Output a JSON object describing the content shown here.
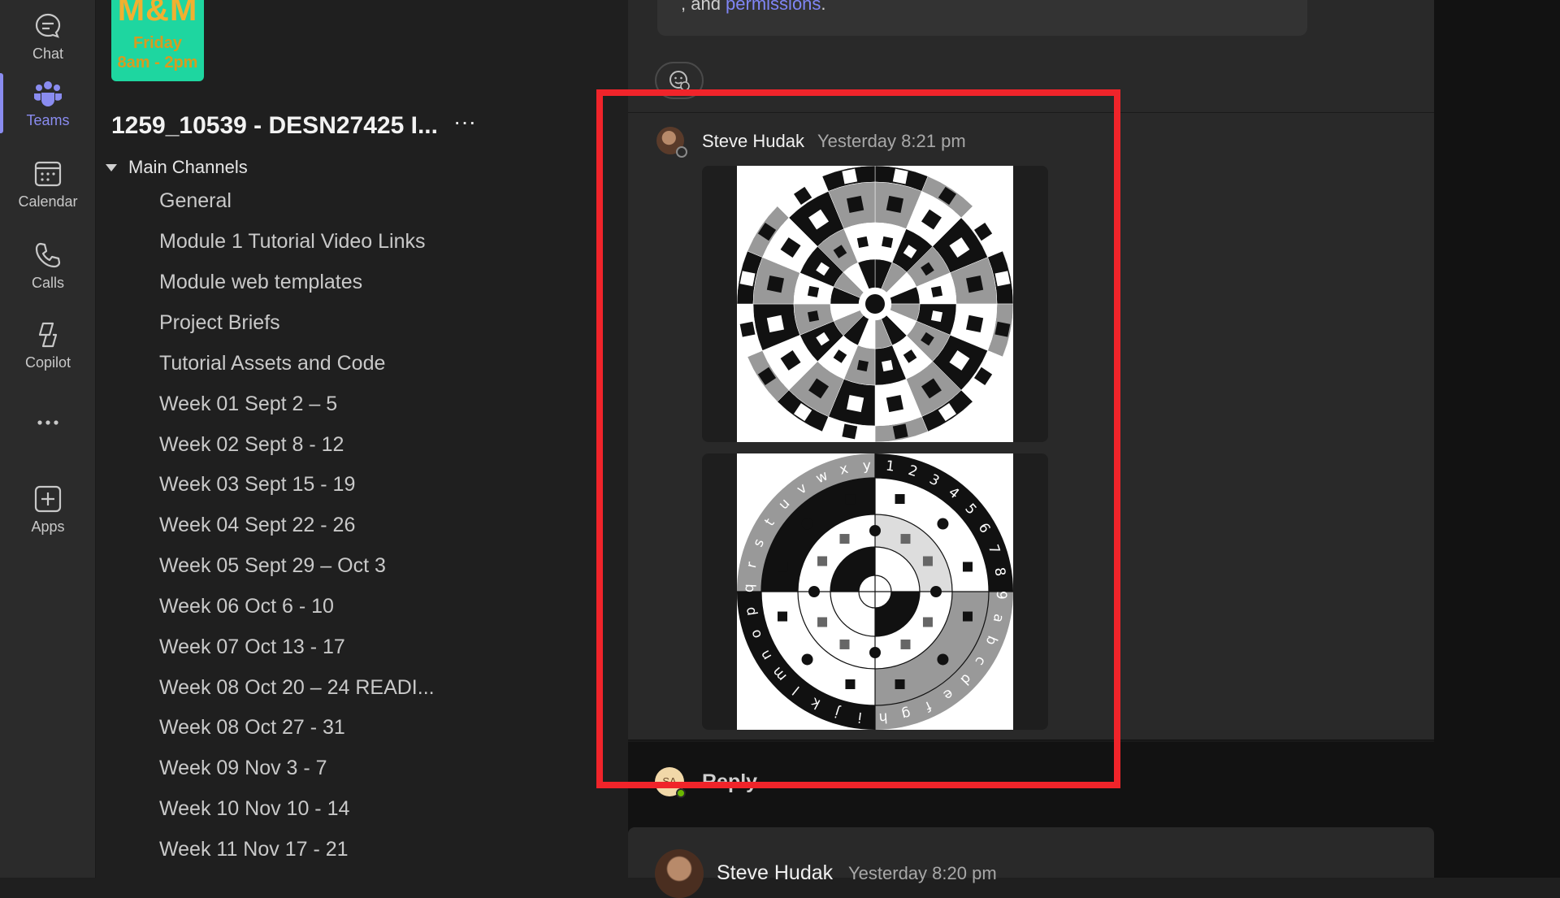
{
  "rail": {
    "items": [
      {
        "label": "Chat",
        "icon": "chat-icon"
      },
      {
        "label": "Teams",
        "icon": "teams-icon",
        "active": true
      },
      {
        "label": "Calendar",
        "icon": "calendar-icon"
      },
      {
        "label": "Calls",
        "icon": "calls-icon"
      },
      {
        "label": "Copilot",
        "icon": "copilot-icon"
      },
      {
        "label": "",
        "icon": "more-icon"
      },
      {
        "label": "Apps",
        "icon": "apps-icon"
      }
    ]
  },
  "team": {
    "tile_big": "M&M",
    "tile_line1": "Friday",
    "tile_line2": "8am - 2pm",
    "name": "1259_10539 - DESN27425 I...",
    "more": "···"
  },
  "channels": {
    "group_label": "Main Channels",
    "items": [
      "General",
      "Module 1 Tutorial Video Links",
      "Module web templates",
      "Project Briefs",
      "Tutorial Assets and Code",
      "Week 01 Sept 2 – 5",
      "Week 02 Sept 8 - 12",
      "Week 03 Sept 15 - 19",
      "Week 04 Sept 22 - 26",
      "Week 05 Sept 29 – Oct 3",
      "Week 06 Oct 6 - 10",
      "Week 07 Oct 13 - 17",
      "Week 08 Oct 20 – 24 READI...",
      "Week 08 Oct 27 - 31",
      "Week 09 Nov 3 - 7",
      "Week 10 Nov 10 - 14",
      "Week 11 Nov 17 - 21"
    ]
  },
  "previous_post": {
    "text_prefix": ", and ",
    "link": "permissions",
    "suffix": "."
  },
  "post": {
    "author": "Steve Hudak",
    "time": "Yesterday 8:21 pm",
    "images": [
      "marker-wheel-image",
      "alphabet-wheel-image"
    ],
    "wheel_letters": "abcdefghijklmnopqrstuvwxy",
    "wheel_digits": "123456789"
  },
  "reply": {
    "avatar_initials": "SA",
    "label": "Reply"
  },
  "next_post": {
    "author": "Steve Hudak",
    "time": "Yesterday 8:20 pm"
  },
  "colors": {
    "accent": "#8a8cf0",
    "highlight": "#f0242a",
    "team_tile": "#1ed6a0"
  }
}
